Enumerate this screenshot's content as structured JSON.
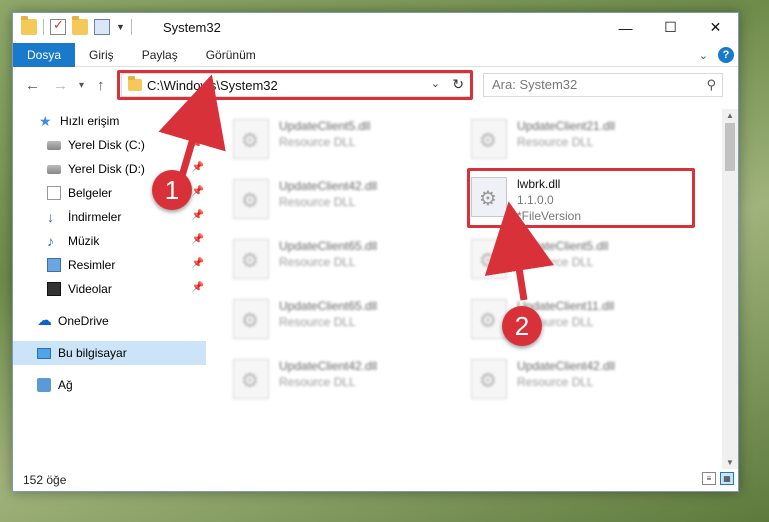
{
  "window": {
    "title": "System32",
    "controls": {
      "minimize": "—",
      "maximize": "☐",
      "close": "✕"
    }
  },
  "ribbon": {
    "tabs": [
      "Dosya",
      "Giriş",
      "Paylaş",
      "Görünüm"
    ],
    "active_tab": "Dosya",
    "help": "?"
  },
  "navbar": {
    "back": "←",
    "forward": "→",
    "recent": "▾",
    "up": "↑",
    "address": "C:\\Windows\\System32",
    "dropdown": "⌄",
    "refresh": "↻",
    "search_placeholder": "Ara: System32",
    "search_icon": "⚲"
  },
  "sidebar": {
    "quick_access": "Hızlı erişim",
    "items": [
      {
        "label": "Yerel Disk (C:)",
        "icon": "drive-icon",
        "pinned": true
      },
      {
        "label": "Yerel Disk (D:)",
        "icon": "drive-icon",
        "pinned": true
      },
      {
        "label": "Belgeler",
        "icon": "documents-icon",
        "pinned": true
      },
      {
        "label": "İndirmeler",
        "icon": "downloads-icon",
        "pinned": true
      },
      {
        "label": "Müzik",
        "icon": "music-icon",
        "pinned": true
      },
      {
        "label": "Resimler",
        "icon": "pictures-icon",
        "pinned": true
      },
      {
        "label": "Videolar",
        "icon": "videos-icon",
        "pinned": true
      }
    ],
    "onedrive": "OneDrive",
    "this_pc": "Bu bilgisayar",
    "network": "Ağ"
  },
  "files": {
    "left": [
      {
        "name": "UpdateClient5.dll",
        "desc": "Resource DLL"
      },
      {
        "name": "UpdateClient42.dll",
        "desc": "Resource DLL"
      },
      {
        "name": "UpdateClient65.dll",
        "desc": "Resource DLL"
      },
      {
        "name": "UpdateClient65.dll",
        "desc": "Resource DLL"
      },
      {
        "name": "UpdateClient42.dll",
        "desc": "Resource DLL"
      }
    ],
    "right": [
      {
        "name": "UpdateClient21.dll",
        "desc": "Resource DLL"
      },
      {
        "name": "UpdateClient5.dll",
        "desc": "Resource DLL"
      },
      {
        "name": "UpdateClient11.dll",
        "desc": "Resource DLL"
      },
      {
        "name": "UpdateClient42.dll",
        "desc": "Resource DLL"
      }
    ],
    "highlighted": {
      "name": "lwbrk.dll",
      "version": "1.1.0.0",
      "file_version": "*FileVersion"
    }
  },
  "status": {
    "count": "152 öğe"
  },
  "callouts": {
    "step1": "1",
    "step2": "2",
    "color": "#d9313a"
  }
}
